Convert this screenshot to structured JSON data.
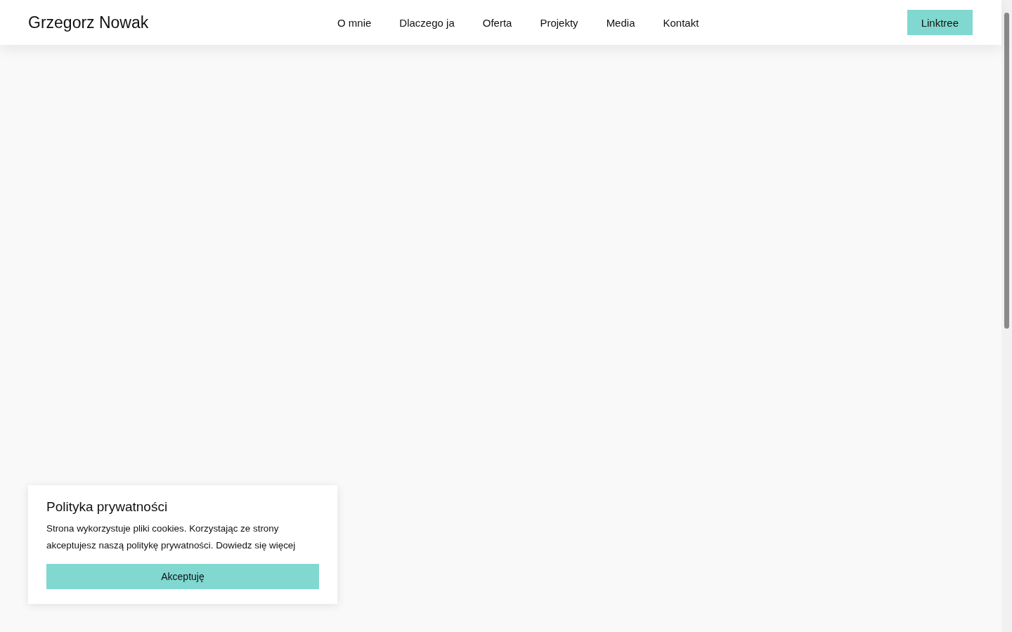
{
  "header": {
    "brand": "Grzegorz Nowak",
    "nav": [
      {
        "label": "O mnie"
      },
      {
        "label": "Dlaczego ja"
      },
      {
        "label": "Oferta"
      },
      {
        "label": "Projekty"
      },
      {
        "label": "Media"
      },
      {
        "label": "Kontakt"
      }
    ],
    "button": "Linktree"
  },
  "cookie_notice": {
    "title": "Polityka prywatności",
    "text": "Strona wykorzystuje pliki cookies. Korzystając ze strony akceptujesz naszą politykę prywatności.",
    "link": "Dowiedz się więcej",
    "button": "Akceptuję"
  }
}
